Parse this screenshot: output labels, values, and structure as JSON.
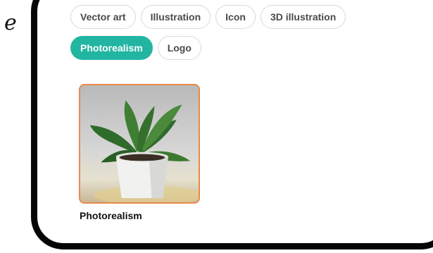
{
  "styles": {
    "row1": [
      "Vector art",
      "Illustration",
      "Icon",
      "3D illustration"
    ],
    "row2": [
      "Photorealism",
      "Logo"
    ],
    "selected": "Photorealism"
  },
  "preview": {
    "label": "Photorealism",
    "image": "potted-plant-icon"
  },
  "colors": {
    "accent": "#22b5a2",
    "card_border": "#e8894a",
    "frame": "#050505"
  }
}
